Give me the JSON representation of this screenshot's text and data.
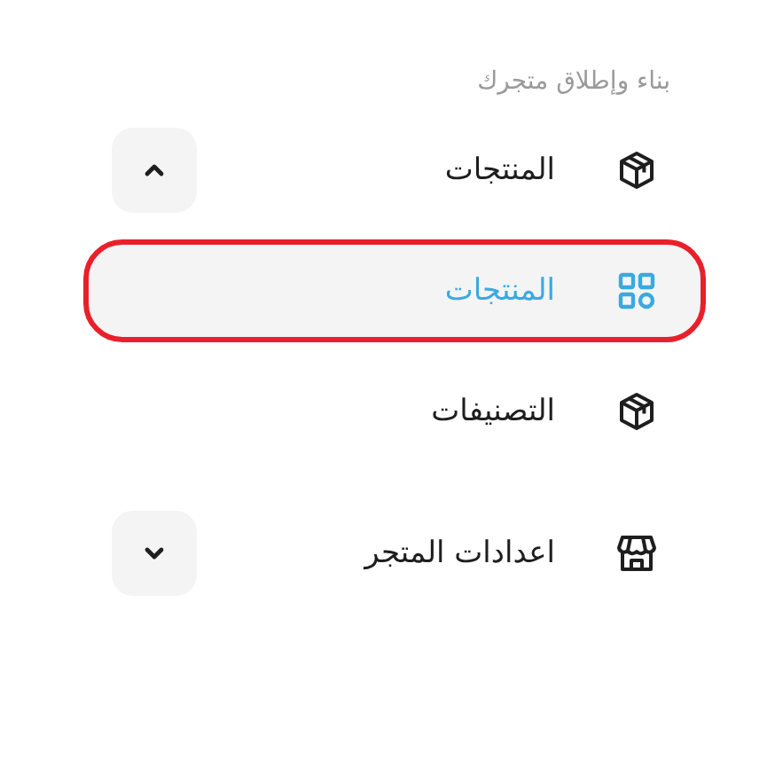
{
  "section": {
    "title": "بناء وإطلاق متجرك"
  },
  "items": [
    {
      "label": "المنتجات",
      "kind": "box",
      "selected": false,
      "expanded": true,
      "children": [
        {
          "label": "المنتجات",
          "kind": "grid",
          "selected": true
        }
      ]
    },
    {
      "label": "التصنيفات",
      "kind": "box",
      "selected": false
    },
    {
      "label": "اعدادات المتجر",
      "kind": "store",
      "selected": false,
      "expanded": false
    }
  ]
}
